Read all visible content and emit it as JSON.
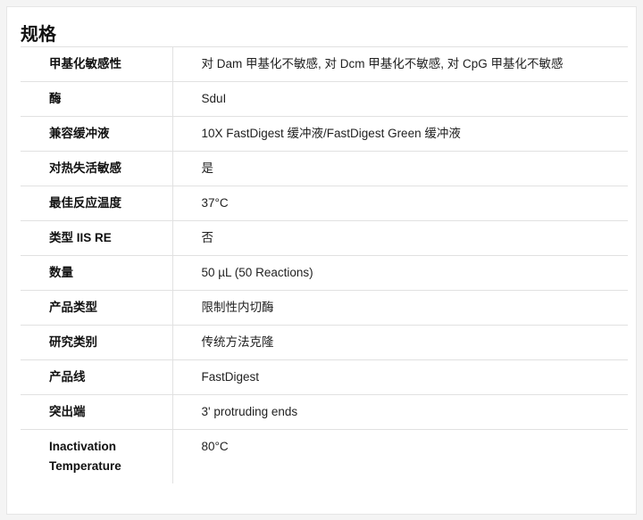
{
  "section": {
    "title": "规格"
  },
  "specs": [
    {
      "label": "甲基化敏感性",
      "value": "对 Dam 甲基化不敏感, 对 Dcm 甲基化不敏感, 对 CpG 甲基化不敏感"
    },
    {
      "label": "酶",
      "value": "SduI"
    },
    {
      "label": "兼容缓冲液",
      "value": "10X FastDigest 缓冲液/FastDigest Green 缓冲液"
    },
    {
      "label": "对热失活敏感",
      "value": "是"
    },
    {
      "label": "最佳反应温度",
      "value": "37°C"
    },
    {
      "label": "类型 IIS RE",
      "value": "否"
    },
    {
      "label": "数量",
      "value": "50 µL (50 Reactions)"
    },
    {
      "label": "产品类型",
      "value": "限制性内切酶"
    },
    {
      "label": "研究类别",
      "value": "传统方法克隆"
    },
    {
      "label": "产品线",
      "value": "FastDigest"
    },
    {
      "label": "突出端",
      "value": "3' protruding ends"
    },
    {
      "label": "Inactivation Temperature",
      "value": "80°C"
    }
  ]
}
